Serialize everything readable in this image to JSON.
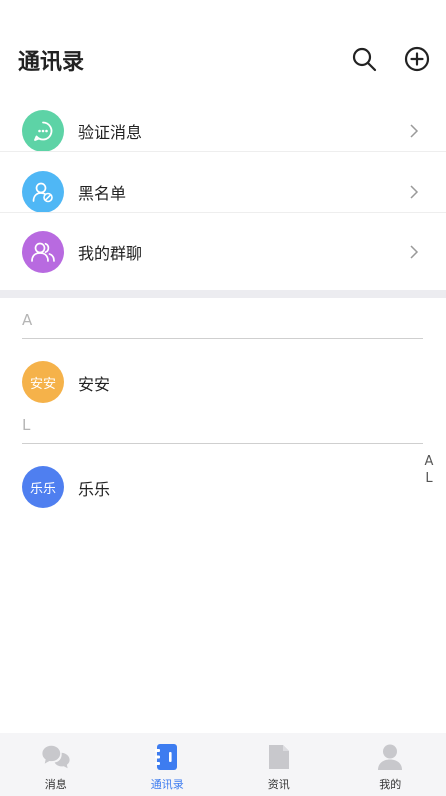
{
  "header": {
    "title": "通讯录",
    "search_icon": "search-icon",
    "add_icon": "add-circle-icon"
  },
  "menu": [
    {
      "label": "验证消息",
      "icon": "chat-bubble-icon",
      "color": "#5dd3a6"
    },
    {
      "label": "黑名单",
      "icon": "blocked-user-icon",
      "color": "#4fb7f5"
    },
    {
      "label": "我的群聊",
      "icon": "group-icon",
      "color": "#b86ae0"
    }
  ],
  "sections": [
    {
      "letter": "A",
      "contacts": [
        {
          "avatar_text": "安安",
          "name": "安安",
          "color": "#f5b24a"
        }
      ]
    },
    {
      "letter": "L",
      "contacts": [
        {
          "avatar_text": "乐乐",
          "name": "乐乐",
          "color": "#4f7ff0"
        }
      ]
    }
  ],
  "index_bar": [
    "A",
    "L"
  ],
  "tabs": [
    {
      "label": "消息",
      "icon": "messages-icon",
      "active": false
    },
    {
      "label": "通讯录",
      "icon": "contacts-icon",
      "active": true
    },
    {
      "label": "资讯",
      "icon": "news-icon",
      "active": false
    },
    {
      "label": "我的",
      "icon": "profile-icon",
      "active": false
    }
  ],
  "colors": {
    "accent": "#3d7cf0",
    "inactive_icon": "#c8c8cc"
  }
}
